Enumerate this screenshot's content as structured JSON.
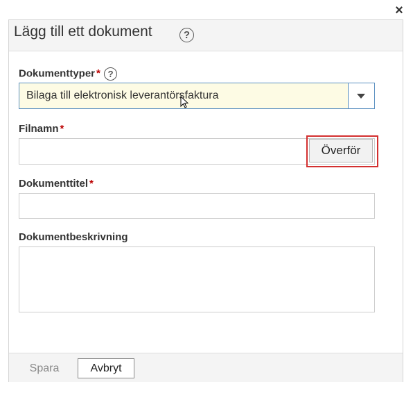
{
  "dialog": {
    "title": "Lägg till ett dokument",
    "close_label": "×"
  },
  "fields": {
    "document_type": {
      "label": "Dokumenttyper",
      "required_mark": "*",
      "selected_value": "Bilaga till elektronisk leverantörsfaktura"
    },
    "filename": {
      "label": "Filnamn",
      "required_mark": "*",
      "value": "",
      "upload_label": "Överför"
    },
    "document_title": {
      "label": "Dokumenttitel",
      "required_mark": "*",
      "value": ""
    },
    "document_description": {
      "label": "Dokumentbeskrivning",
      "value": ""
    }
  },
  "footer": {
    "save_label": "Spara",
    "cancel_label": "Avbryt"
  },
  "icons": {
    "help": "?",
    "close": "close-icon",
    "dropdown": "chevron-down-icon"
  },
  "colors": {
    "required": "#bb0000",
    "highlight": "#d32f2f",
    "select_border": "#5a8fc0",
    "select_bg": "#fdfbe4"
  }
}
